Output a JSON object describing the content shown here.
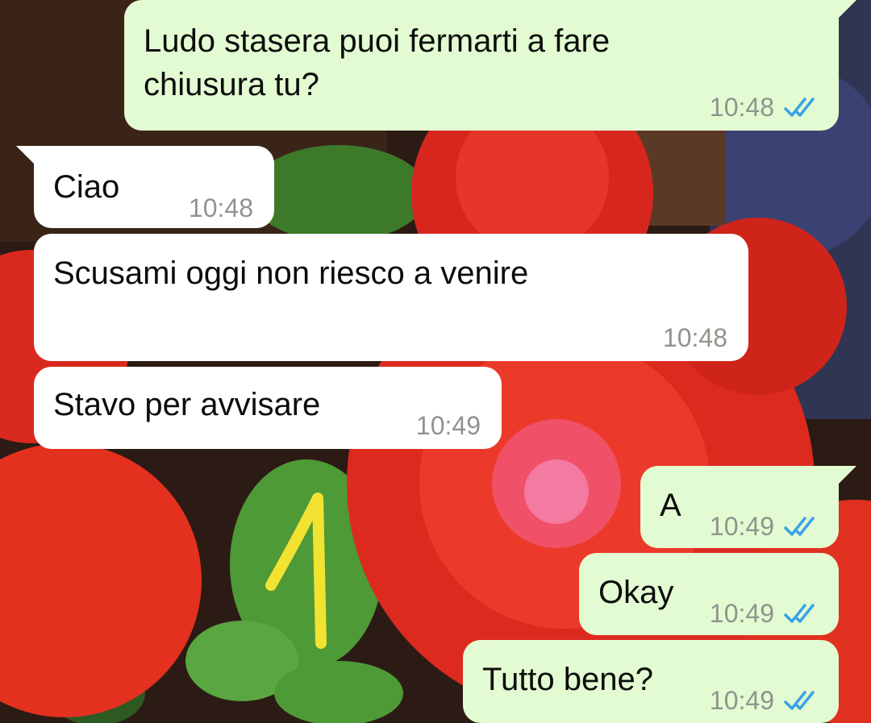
{
  "colors": {
    "incoming_bubble": "#ffffff",
    "outgoing_bubble": "#e3fbd2",
    "timestamp": "#8e958c",
    "read_tick": "#3aa2e6",
    "annotation": "#f2e232"
  },
  "messages": [
    {
      "direction": "outgoing",
      "text_lines": [
        "Ludo stasera puoi fermarti a fare",
        "chiusura tu?"
      ],
      "time": "10:48",
      "status_icon": "double-check-read-icon"
    },
    {
      "direction": "incoming",
      "text_lines": [
        "Ciao"
      ],
      "time": "10:48"
    },
    {
      "direction": "incoming",
      "text_lines": [
        "Scusami oggi non riesco a venire"
      ],
      "time": "10:48"
    },
    {
      "direction": "incoming",
      "text_lines": [
        "Stavo per avvisare"
      ],
      "time": "10:49"
    },
    {
      "direction": "outgoing",
      "text_lines": [
        "A"
      ],
      "time": "10:49",
      "status_icon": "double-check-read-icon"
    },
    {
      "direction": "outgoing",
      "text_lines": [
        "Okay"
      ],
      "time": "10:49",
      "status_icon": "double-check-read-icon"
    },
    {
      "direction": "outgoing",
      "text_lines": [
        "Tutto bene?"
      ],
      "time": "10:49",
      "status_icon": "double-check-read-icon"
    }
  ],
  "annotation": {
    "shape": "handwritten-arrow-up"
  }
}
